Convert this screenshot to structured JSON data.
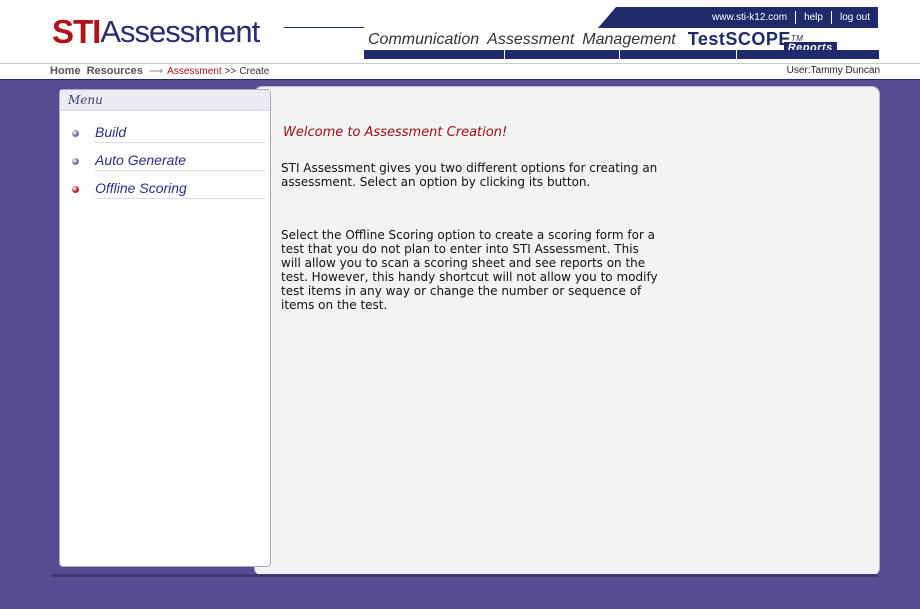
{
  "header": {
    "logo_sti": "STI",
    "logo_rest": "Assessment",
    "top_links": [
      "www.sti-k12.com",
      "help",
      "log out"
    ],
    "nav": [
      "Communication",
      "Assessment",
      "Management"
    ],
    "product": {
      "name": "TestSCOPE",
      "tm": "TM",
      "sub": "Reports"
    }
  },
  "breadcrumb": {
    "home": "Home",
    "resources": "Resources",
    "arrow": "⟶",
    "current": "Assessment",
    "separator": ">>",
    "last": "Create",
    "user": "User:Tammy Duncan"
  },
  "sidebar": {
    "title": "Menu",
    "items": [
      {
        "label": "Build",
        "color": "#6b6e9c"
      },
      {
        "label": "Auto Generate",
        "color": "#6b6e9c"
      },
      {
        "label": "Offline Scoring",
        "color": "#b3222a"
      }
    ]
  },
  "content": {
    "title": "Welcome to Assessment Creation!",
    "paragraph1": "STI Assessment gives you two different options for creating an assessment. Select an option by clicking its button.",
    "paragraph2": "Select the Offline Scoring option to create a scoring form for a test that you do not plan to enter into STI Assessment.  This will allow you to scan a scoring sheet and see reports on the test.  However, this handy shortcut will not allow you to modify test items in any way or change the number or sequence of items on the test."
  },
  "colors": {
    "brand_red": "#b0121a",
    "navy": "#1f2a6a",
    "background_purple": "#574c91"
  }
}
